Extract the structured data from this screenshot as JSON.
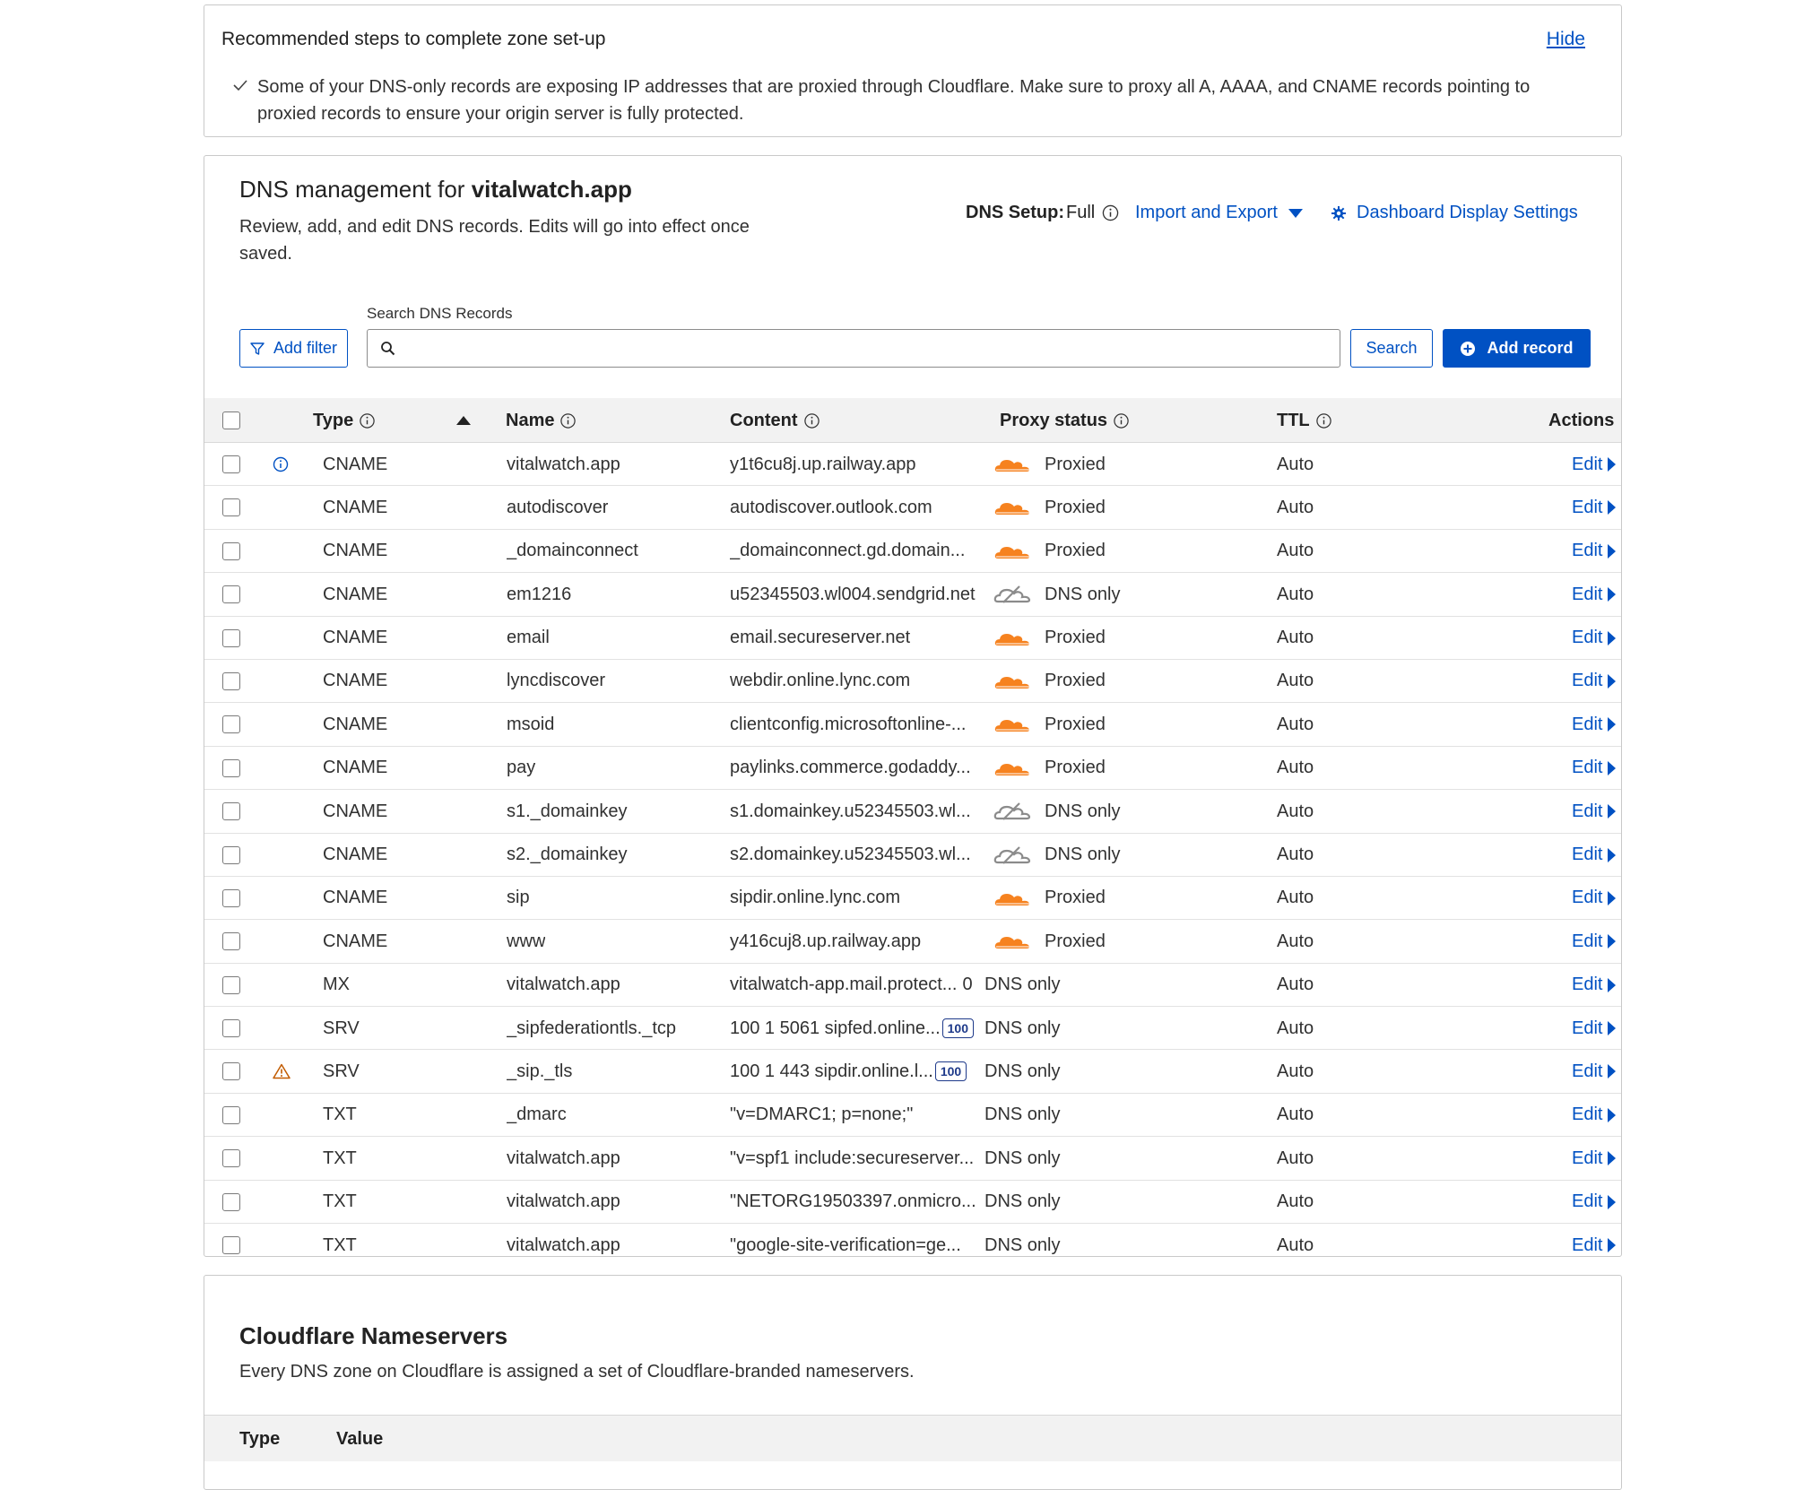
{
  "recommended": {
    "title": "Recommended steps to complete zone set-up",
    "hide_label": "Hide",
    "message": "Some of your DNS-only records are exposing IP addresses that are proxied through Cloudflare. Make sure to proxy all A, AAAA, and CNAME records pointing to proxied records to ensure your origin server is fully protected."
  },
  "dns": {
    "title_prefix": "DNS management for",
    "domain": "vitalwatch.app",
    "description": "Review, add, and edit DNS records. Edits will go into effect once saved.",
    "setup_label": "DNS Setup:",
    "setup_value": "Full",
    "import_export": "Import and Export",
    "display_settings": "Dashboard Display Settings",
    "search_label": "Search DNS Records",
    "search_value": "",
    "add_filter": "Add filter",
    "search_button": "Search",
    "add_record": "Add record",
    "columns": {
      "type": "Type",
      "name": "Name",
      "content": "Content",
      "proxy": "Proxy status",
      "ttl": "TTL",
      "actions": "Actions"
    },
    "colors": {
      "accent": "#0051c3",
      "proxied_cloud": "#f6821f",
      "dns_only_cloud": "#8b8b8b",
      "warning": "#c25b00"
    },
    "records": [
      {
        "flag": "info",
        "type": "CNAME",
        "name": "vitalwatch.app",
        "content": "y1t6cu8j.up.railway.app",
        "priority": "",
        "proxy": "Proxied",
        "cloud": "proxied",
        "ttl": "Auto",
        "action": "Edit"
      },
      {
        "flag": "",
        "type": "CNAME",
        "name": "autodiscover",
        "content": "autodiscover.outlook.com",
        "priority": "",
        "proxy": "Proxied",
        "cloud": "proxied",
        "ttl": "Auto",
        "action": "Edit"
      },
      {
        "flag": "",
        "type": "CNAME",
        "name": "_domainconnect",
        "content": "_domainconnect.gd.domain...",
        "priority": "",
        "proxy": "Proxied",
        "cloud": "proxied",
        "ttl": "Auto",
        "action": "Edit"
      },
      {
        "flag": "",
        "type": "CNAME",
        "name": "em1216",
        "content": "u52345503.wl004.sendgrid.net",
        "priority": "",
        "proxy": "DNS only",
        "cloud": "dns",
        "ttl": "Auto",
        "action": "Edit"
      },
      {
        "flag": "",
        "type": "CNAME",
        "name": "email",
        "content": "email.secureserver.net",
        "priority": "",
        "proxy": "Proxied",
        "cloud": "proxied",
        "ttl": "Auto",
        "action": "Edit"
      },
      {
        "flag": "",
        "type": "CNAME",
        "name": "lyncdiscover",
        "content": "webdir.online.lync.com",
        "priority": "",
        "proxy": "Proxied",
        "cloud": "proxied",
        "ttl": "Auto",
        "action": "Edit"
      },
      {
        "flag": "",
        "type": "CNAME",
        "name": "msoid",
        "content": "clientconfig.microsoftonline-...",
        "priority": "",
        "proxy": "Proxied",
        "cloud": "proxied",
        "ttl": "Auto",
        "action": "Edit"
      },
      {
        "flag": "",
        "type": "CNAME",
        "name": "pay",
        "content": "paylinks.commerce.godaddy...",
        "priority": "",
        "proxy": "Proxied",
        "cloud": "proxied",
        "ttl": "Auto",
        "action": "Edit"
      },
      {
        "flag": "",
        "type": "CNAME",
        "name": "s1._domainkey",
        "content": "s1.domainkey.u52345503.wl...",
        "priority": "",
        "proxy": "DNS only",
        "cloud": "dns",
        "ttl": "Auto",
        "action": "Edit"
      },
      {
        "flag": "",
        "type": "CNAME",
        "name": "s2._domainkey",
        "content": "s2.domainkey.u52345503.wl...",
        "priority": "",
        "proxy": "DNS only",
        "cloud": "dns",
        "ttl": "Auto",
        "action": "Edit"
      },
      {
        "flag": "",
        "type": "CNAME",
        "name": "sip",
        "content": "sipdir.online.lync.com",
        "priority": "",
        "proxy": "Proxied",
        "cloud": "proxied",
        "ttl": "Auto",
        "action": "Edit"
      },
      {
        "flag": "",
        "type": "CNAME",
        "name": "www",
        "content": "y416cuj8.up.railway.app",
        "priority": "",
        "proxy": "Proxied",
        "cloud": "proxied",
        "ttl": "Auto",
        "action": "Edit"
      },
      {
        "flag": "",
        "type": "MX",
        "name": "vitalwatch.app",
        "content": "vitalwatch-app.mail.protect...",
        "priority": "0",
        "priority_style": "plain",
        "proxy": "DNS only",
        "cloud": "none",
        "ttl": "Auto",
        "action": "Edit"
      },
      {
        "flag": "",
        "type": "SRV",
        "name": "_sipfederationtls._tcp",
        "content": "100 1 5061 sipfed.online...",
        "priority": "100",
        "priority_style": "badge",
        "proxy": "DNS only",
        "cloud": "none",
        "ttl": "Auto",
        "action": "Edit"
      },
      {
        "flag": "warning",
        "type": "SRV",
        "name": "_sip._tls",
        "content": "100 1 443 sipdir.online.l...",
        "priority": "100",
        "priority_style": "badge",
        "proxy": "DNS only",
        "cloud": "none",
        "ttl": "Auto",
        "action": "Edit"
      },
      {
        "flag": "",
        "type": "TXT",
        "name": "_dmarc",
        "content": "\"v=DMARC1; p=none;\"",
        "priority": "",
        "proxy": "DNS only",
        "cloud": "none",
        "ttl": "Auto",
        "action": "Edit"
      },
      {
        "flag": "",
        "type": "TXT",
        "name": "vitalwatch.app",
        "content": "\"v=spf1 include:secureserver...",
        "priority": "",
        "proxy": "DNS only",
        "cloud": "none",
        "ttl": "Auto",
        "action": "Edit"
      },
      {
        "flag": "",
        "type": "TXT",
        "name": "vitalwatch.app",
        "content": "\"NETORG19503397.onmicro...",
        "priority": "",
        "proxy": "DNS only",
        "cloud": "none",
        "ttl": "Auto",
        "action": "Edit"
      },
      {
        "flag": "",
        "type": "TXT",
        "name": "vitalwatch.app",
        "content": "\"google-site-verification=ge...",
        "priority": "",
        "proxy": "DNS only",
        "cloud": "none",
        "ttl": "Auto",
        "action": "Edit"
      }
    ]
  },
  "nameservers": {
    "title": "Cloudflare Nameservers",
    "description": "Every DNS zone on Cloudflare is assigned a set of Cloudflare-branded nameservers.",
    "columns": {
      "type": "Type",
      "value": "Value"
    }
  }
}
